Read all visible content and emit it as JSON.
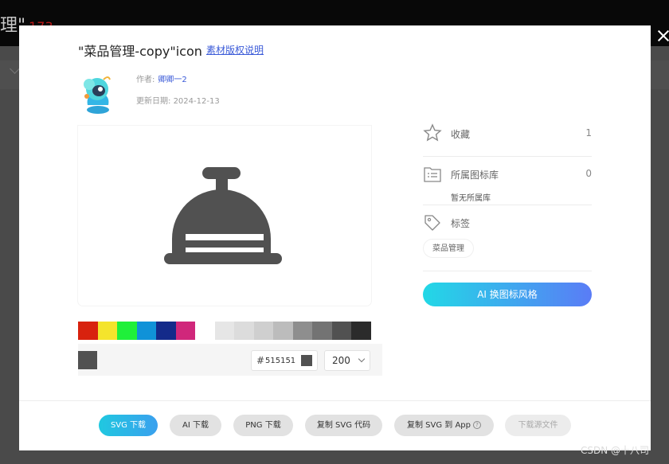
{
  "background": {
    "title": "理\"",
    "title_red": "173",
    "watermark": "CSDN @十八司"
  },
  "modal": {
    "title": "\"菜品管理-copy\"icon",
    "license_link": "素材版权说明",
    "author_label": "作者:",
    "author_name": "卿卿一2",
    "date_label": "更新日期:",
    "date_value": "2024-12-13",
    "icon_semantic": "service-bell-icon"
  },
  "color_palette": {
    "swatches": [
      "#d8220e",
      "#f4e42c",
      "#1ff03a",
      "#1092d8",
      "#142a8a",
      "#d0277b",
      "#ffffff",
      "#e6e6e6",
      "#dcdcdc",
      "#cfcfcf",
      "#bcbcbc",
      "#8e8e8e",
      "#737373",
      "#515151",
      "#2b2b2b"
    ],
    "current_color": "#515151",
    "hex_prefix": "#",
    "hex_value": "515151",
    "size_value": "200"
  },
  "info_panel": {
    "favorite_label": "收藏",
    "favorite_count": "1",
    "library_label": "所属图标库",
    "library_count": "0",
    "library_none": "暂无所属库",
    "tags_label": "标签",
    "tag": "菜品管理",
    "ai_button": "AI 换图标风格"
  },
  "footer": {
    "svg_download": "SVG 下载",
    "ai_download": "AI 下载",
    "png_download": "PNG 下载",
    "copy_svg_code": "复制 SVG 代码",
    "copy_svg_app": "复制 SVG 到 App",
    "app_info": "?",
    "download_source": "下载源文件"
  }
}
